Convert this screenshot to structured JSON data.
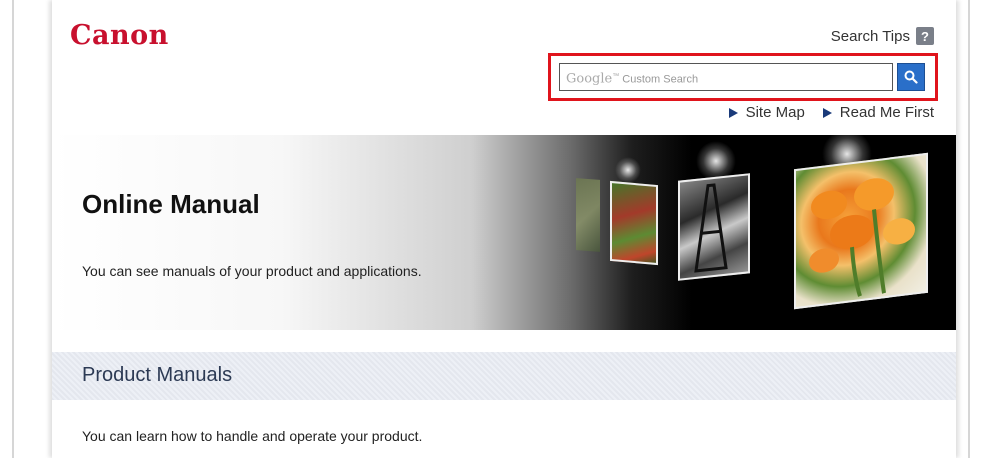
{
  "header": {
    "logo_text": "Canon",
    "search_tips_label": "Search Tips",
    "help_icon_glyph": "?",
    "search": {
      "google_word": "Google",
      "tm": "™",
      "placeholder_suffix": "Custom Search"
    },
    "links": [
      {
        "label": "Site Map",
        "icon": "triangle-right-icon"
      },
      {
        "label": "Read Me First",
        "icon": "triangle-right-icon"
      }
    ]
  },
  "banner": {
    "title": "Online Manual",
    "subtitle": "You can see manuals of your product and applications."
  },
  "section": {
    "title": "Product Manuals",
    "description": "You can learn how to handle and operate your product."
  },
  "colors": {
    "brand_red": "#c8102e",
    "highlight_red": "#e0141c",
    "search_button_blue": "#2a6fc9"
  }
}
